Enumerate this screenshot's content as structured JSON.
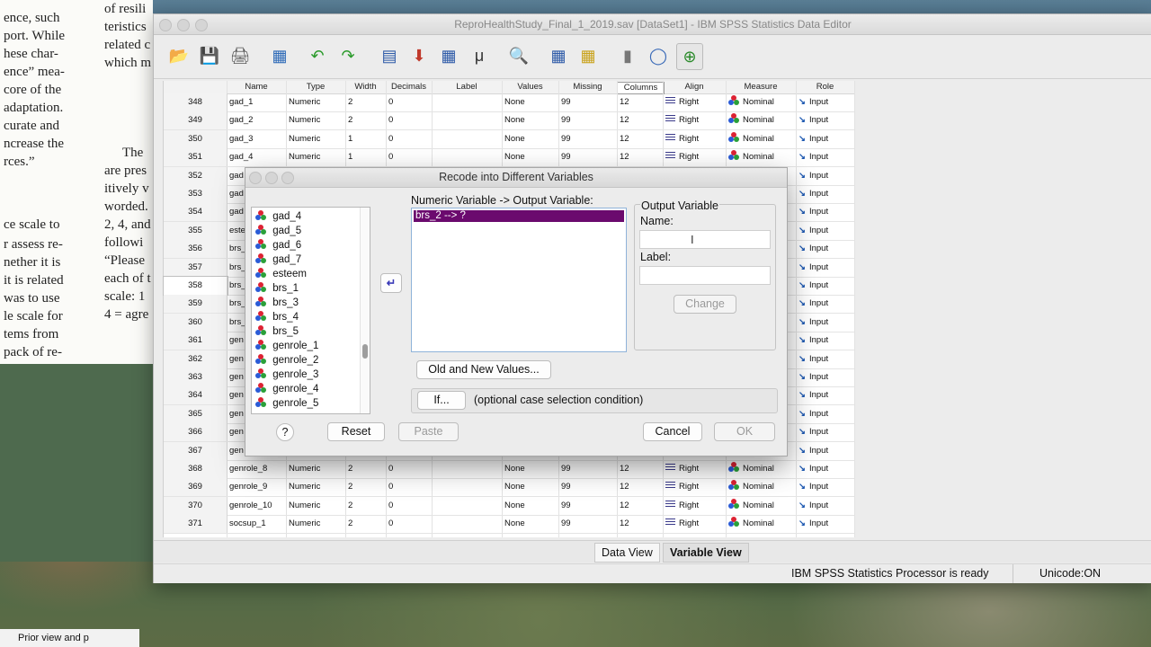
{
  "window": {
    "title": "ReproHealthStudy_Final_1_2019.sav [DataSet1] - IBM SPSS Statistics Data Editor"
  },
  "background_doc": {
    "lines": [
      "ence, such",
      "port. While",
      "hese char-",
      "ence” mea-",
      "core of the",
      "adaptation.",
      "curate and",
      "ncrease the",
      "rces.”",
      "",
      "The",
      "are pres",
      "itively v",
      "worded.",
      "2, 4, and",
      "followi",
      "“Please",
      "each of t",
      "scale: 1",
      "4 = agre",
      "ce scale to",
      "r assess re-",
      "nether it is",
      "it is related",
      "was to use",
      "le scale for",
      "tems from",
      "pack of re-"
    ],
    "col2": [
      "of resili",
      "teristics",
      "related c",
      "which m"
    ],
    "bottom_snippet": "Prior view and p"
  },
  "grid": {
    "headers": [
      "Name",
      "Type",
      "Width",
      "Decimals",
      "Label",
      "Values",
      "Missing",
      "Columns",
      "Align",
      "Measure",
      "Role"
    ],
    "rows": [
      {
        "n": "348",
        "name": "gad_1",
        "type": "Numeric",
        "width": "2",
        "dec": "0",
        "values": "None",
        "missing": "99",
        "cols": "12",
        "align": "Right",
        "measure": "Nominal",
        "role": "Input"
      },
      {
        "n": "349",
        "name": "gad_2",
        "type": "Numeric",
        "width": "2",
        "dec": "0",
        "values": "None",
        "missing": "99",
        "cols": "12",
        "align": "Right",
        "measure": "Nominal",
        "role": "Input"
      },
      {
        "n": "350",
        "name": "gad_3",
        "type": "Numeric",
        "width": "1",
        "dec": "0",
        "values": "None",
        "missing": "99",
        "cols": "12",
        "align": "Right",
        "measure": "Nominal",
        "role": "Input"
      },
      {
        "n": "351",
        "name": "gad_4",
        "type": "Numeric",
        "width": "1",
        "dec": "0",
        "values": "None",
        "missing": "99",
        "cols": "12",
        "align": "Right",
        "measure": "Nominal",
        "role": "Input"
      },
      {
        "n": "352",
        "name": "gad",
        "role": "Input"
      },
      {
        "n": "353",
        "name": "gad",
        "role": "Input"
      },
      {
        "n": "354",
        "name": "gad",
        "role": "Input"
      },
      {
        "n": "355",
        "name": "este",
        "role": "Input"
      },
      {
        "n": "356",
        "name": "brs_",
        "role": "Input"
      },
      {
        "n": "357",
        "name": "brs_",
        "role": "Input"
      },
      {
        "n": "358",
        "name": "brs_",
        "role": "Input"
      },
      {
        "n": "359",
        "name": "brs_",
        "role": "Input"
      },
      {
        "n": "360",
        "name": "brs_",
        "role": "Input"
      },
      {
        "n": "361",
        "name": "gen",
        "role": "Input"
      },
      {
        "n": "362",
        "name": "gen",
        "role": "Input"
      },
      {
        "n": "363",
        "name": "gen",
        "role": "Input"
      },
      {
        "n": "364",
        "name": "gen",
        "role": "Input"
      },
      {
        "n": "365",
        "name": "gen",
        "role": "Input"
      },
      {
        "n": "366",
        "name": "gen",
        "role": "Input"
      },
      {
        "n": "367",
        "name": "gen",
        "role": "Input"
      },
      {
        "n": "368",
        "name": "genrole_8",
        "type": "Numeric",
        "width": "2",
        "dec": "0",
        "values": "None",
        "missing": "99",
        "cols": "12",
        "align": "Right",
        "measure": "Nominal",
        "role": "Input"
      },
      {
        "n": "369",
        "name": "genrole_9",
        "type": "Numeric",
        "width": "2",
        "dec": "0",
        "values": "None",
        "missing": "99",
        "cols": "12",
        "align": "Right",
        "measure": "Nominal",
        "role": "Input"
      },
      {
        "n": "370",
        "name": "genrole_10",
        "type": "Numeric",
        "width": "2",
        "dec": "0",
        "values": "None",
        "missing": "99",
        "cols": "12",
        "align": "Right",
        "measure": "Nominal",
        "role": "Input"
      },
      {
        "n": "371",
        "name": "socsup_1",
        "type": "Numeric",
        "width": "2",
        "dec": "0",
        "values": "None",
        "missing": "99",
        "cols": "12",
        "align": "Right",
        "measure": "Nominal",
        "role": "Input"
      }
    ]
  },
  "tabs": {
    "data_view": "Data View",
    "variable_view": "Variable View"
  },
  "status": {
    "processor": "IBM SPSS Statistics Processor is ready",
    "unicode": "Unicode:ON"
  },
  "dialog": {
    "title": "Recode into Different Variables",
    "variables": [
      "gad_4",
      "gad_5",
      "gad_6",
      "gad_7",
      "esteem",
      "brs_1",
      "brs_3",
      "brs_4",
      "brs_5",
      "genrole_1",
      "genrole_2",
      "genrole_3",
      "genrole_4",
      "genrole_5"
    ],
    "mapping_label": "Numeric Variable -> Output Variable:",
    "mapping_selected": "brs_2 --> ?",
    "output_group": "Output Variable",
    "name_label": "Name:",
    "label_label": "Label:",
    "change": "Change",
    "old_new": "Old and New Values...",
    "if_button": "If...",
    "if_desc": "(optional case selection condition)",
    "help": "?",
    "reset": "Reset",
    "paste": "Paste",
    "cancel": "Cancel",
    "ok": "OK"
  }
}
